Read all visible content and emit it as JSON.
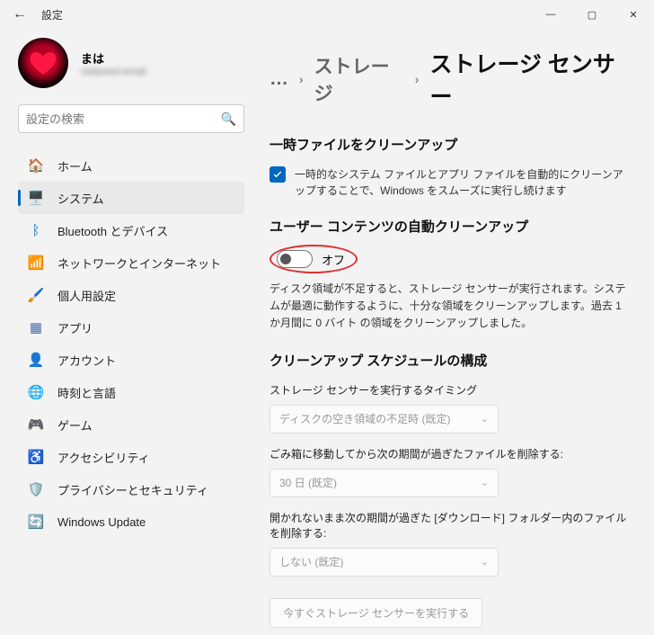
{
  "window": {
    "title": "設定"
  },
  "profile": {
    "name": "まは",
    "sub": "redacted-email"
  },
  "search": {
    "placeholder": "設定の検索"
  },
  "nav": [
    {
      "label": "ホーム",
      "icon": "home"
    },
    {
      "label": "システム",
      "icon": "system",
      "active": true
    },
    {
      "label": "Bluetooth とデバイス",
      "icon": "bluetooth"
    },
    {
      "label": "ネットワークとインターネット",
      "icon": "network"
    },
    {
      "label": "個人用設定",
      "icon": "personalize"
    },
    {
      "label": "アプリ",
      "icon": "apps"
    },
    {
      "label": "アカウント",
      "icon": "account"
    },
    {
      "label": "時刻と言語",
      "icon": "time"
    },
    {
      "label": "ゲーム",
      "icon": "gaming"
    },
    {
      "label": "アクセシビリティ",
      "icon": "accessibility"
    },
    {
      "label": "プライバシーとセキュリティ",
      "icon": "privacy"
    },
    {
      "label": "Windows Update",
      "icon": "update"
    }
  ],
  "breadcrumb": {
    "dots": "…",
    "mid": "ストレージ",
    "current": "ストレージ センサー"
  },
  "sections": {
    "temp_title": "一時ファイルをクリーンアップ",
    "temp_check": "一時的なシステム ファイルとアプリ ファイルを自動的にクリーンアップすることで、Windows をスムーズに実行し続けます",
    "auto_title": "ユーザー コンテンツの自動クリーンアップ",
    "toggle_state": "オフ",
    "auto_desc": "ディスク領域が不足すると、ストレージ センサーが実行されます。システムが最適に動作するように、十分な領域をクリーンアップします。過去 1 か月間に 0 バイト の領域をクリーンアップしました。",
    "sched_title": "クリーンアップ スケジュールの構成",
    "f1_label": "ストレージ センサーを実行するタイミング",
    "f1_value": "ディスクの空き領域の不足時 (既定)",
    "f2_label": "ごみ箱に移動してから次の期間が過ぎたファイルを削除する:",
    "f2_value": "30 日 (既定)",
    "f3_label": "開かれないまま次の期間が過ぎた [ダウンロード] フォルダー内のファイルを削除する:",
    "f3_value": "しない (既定)",
    "run_btn": "今すぐストレージ センサーを実行する"
  }
}
